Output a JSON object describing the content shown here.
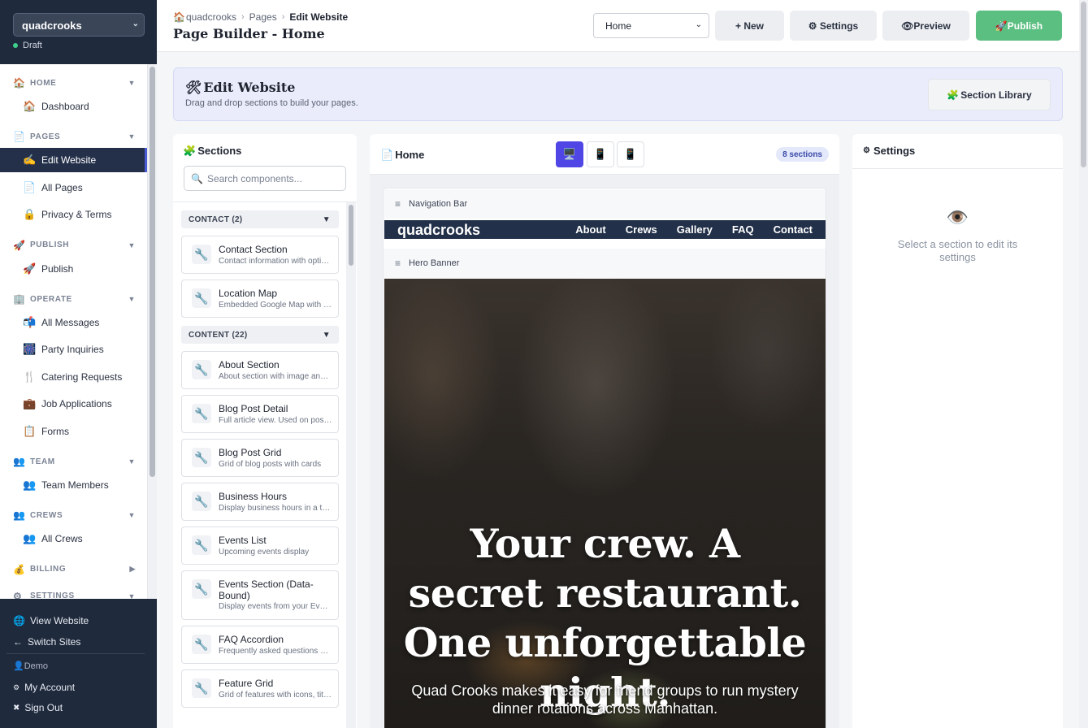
{
  "site": {
    "name": "quadcrooks",
    "status": "Draft"
  },
  "sidebar": {
    "groups": [
      {
        "icon": "🏠",
        "label": "HOME",
        "arrow": "▼",
        "items": [
          {
            "icon": "🏠",
            "label": "Dashboard"
          }
        ]
      },
      {
        "icon": "📄",
        "label": "PAGES",
        "arrow": "▼",
        "items": [
          {
            "icon": "✍️",
            "label": "Edit Website",
            "active": true
          },
          {
            "icon": "📄",
            "label": "All Pages"
          },
          {
            "icon": "🔒",
            "label": "Privacy & Terms"
          }
        ]
      },
      {
        "icon": "🚀",
        "label": "PUBLISH",
        "arrow": "▼",
        "items": [
          {
            "icon": "🚀",
            "label": "Publish"
          }
        ]
      },
      {
        "icon": "🏢",
        "label": "OPERATE",
        "arrow": "▼",
        "items": [
          {
            "icon": "📬",
            "label": "All Messages"
          },
          {
            "icon": "🎆",
            "label": "Party Inquiries"
          },
          {
            "icon": "🍴",
            "label": "Catering Requests"
          },
          {
            "icon": "💼",
            "label": "Job Applications"
          },
          {
            "icon": "📋",
            "label": "Forms"
          }
        ]
      },
      {
        "icon": "👥",
        "label": "TEAM",
        "arrow": "▼",
        "items": [
          {
            "icon": "👥",
            "label": "Team Members"
          }
        ]
      },
      {
        "icon": "👥",
        "label": "CREWS",
        "arrow": "▼",
        "items": [
          {
            "icon": "👥",
            "label": "All Crews"
          }
        ]
      },
      {
        "icon": "💰",
        "label": "BILLING",
        "arrow": "▶",
        "items": []
      },
      {
        "icon": "⚙",
        "label": "SETTINGS",
        "arrow": "▼",
        "items": []
      }
    ],
    "bottom": {
      "view_website": "View Website",
      "switch_sites": "Switch Sites",
      "user": "Demo",
      "my_account": "My Account",
      "sign_out": "Sign Out"
    }
  },
  "header": {
    "breadcrumb": [
      "quadcrooks",
      "Pages",
      "Edit Website"
    ],
    "title": "Page Builder - Home",
    "page_select": "Home",
    "new_label": "+ New",
    "settings_label": "⚙ Settings",
    "preview_label": "👁Preview",
    "publish_label": "🚀Publish"
  },
  "banner": {
    "title": "Edit Website",
    "subtitle": "Drag and drop sections to build your pages.",
    "library_label": "Section Library"
  },
  "sections_panel": {
    "title": "Sections",
    "search_placeholder": "Search components...",
    "categories": [
      {
        "label": "CONTACT (2)",
        "arrow": "▼",
        "items": [
          {
            "name": "Contact Section",
            "desc": "Contact information with optional form"
          },
          {
            "name": "Location Map",
            "desc": "Embedded Google Map with address"
          }
        ]
      },
      {
        "label": "CONTENT (22)",
        "arrow": "▼",
        "items": [
          {
            "name": "About Section",
            "desc": "About section with image and text"
          },
          {
            "name": "Blog Post Detail",
            "desc": "Full article view. Used on post pages"
          },
          {
            "name": "Blog Post Grid",
            "desc": "Grid of blog posts with cards"
          },
          {
            "name": "Business Hours",
            "desc": "Display business hours in a table"
          },
          {
            "name": "Events List",
            "desc": "Upcoming events display"
          },
          {
            "name": "Events Section (Data-Bound)",
            "desc": "Display events from your Events data"
          },
          {
            "name": "FAQ Accordion",
            "desc": "Frequently asked questions accordion"
          },
          {
            "name": "Feature Grid",
            "desc": "Grid of features with icons, titles"
          }
        ]
      }
    ]
  },
  "canvas": {
    "title": "Home",
    "devices": [
      "desktop",
      "tablet",
      "mobile"
    ],
    "section_count": "8 sections",
    "sections": [
      {
        "label": "Navigation Bar"
      },
      {
        "label": "Hero Banner"
      }
    ],
    "site_nav": {
      "logo": "quadcrooks",
      "links": [
        "About",
        "Crews",
        "Gallery",
        "FAQ",
        "Contact"
      ]
    },
    "hero": {
      "headline": "Your crew. A secret restaurant. One unforgettable night.",
      "subtext": "Quad Crooks makes it easy for friend groups to run mystery dinner rotations across Manhattan."
    }
  },
  "settings_panel": {
    "title": "Settings",
    "empty_text": "Select a section to edit its settings"
  },
  "colors": {
    "sidebar": "#1f2a3c",
    "accent": "#4f46e5",
    "publish": "#5cbf82"
  }
}
